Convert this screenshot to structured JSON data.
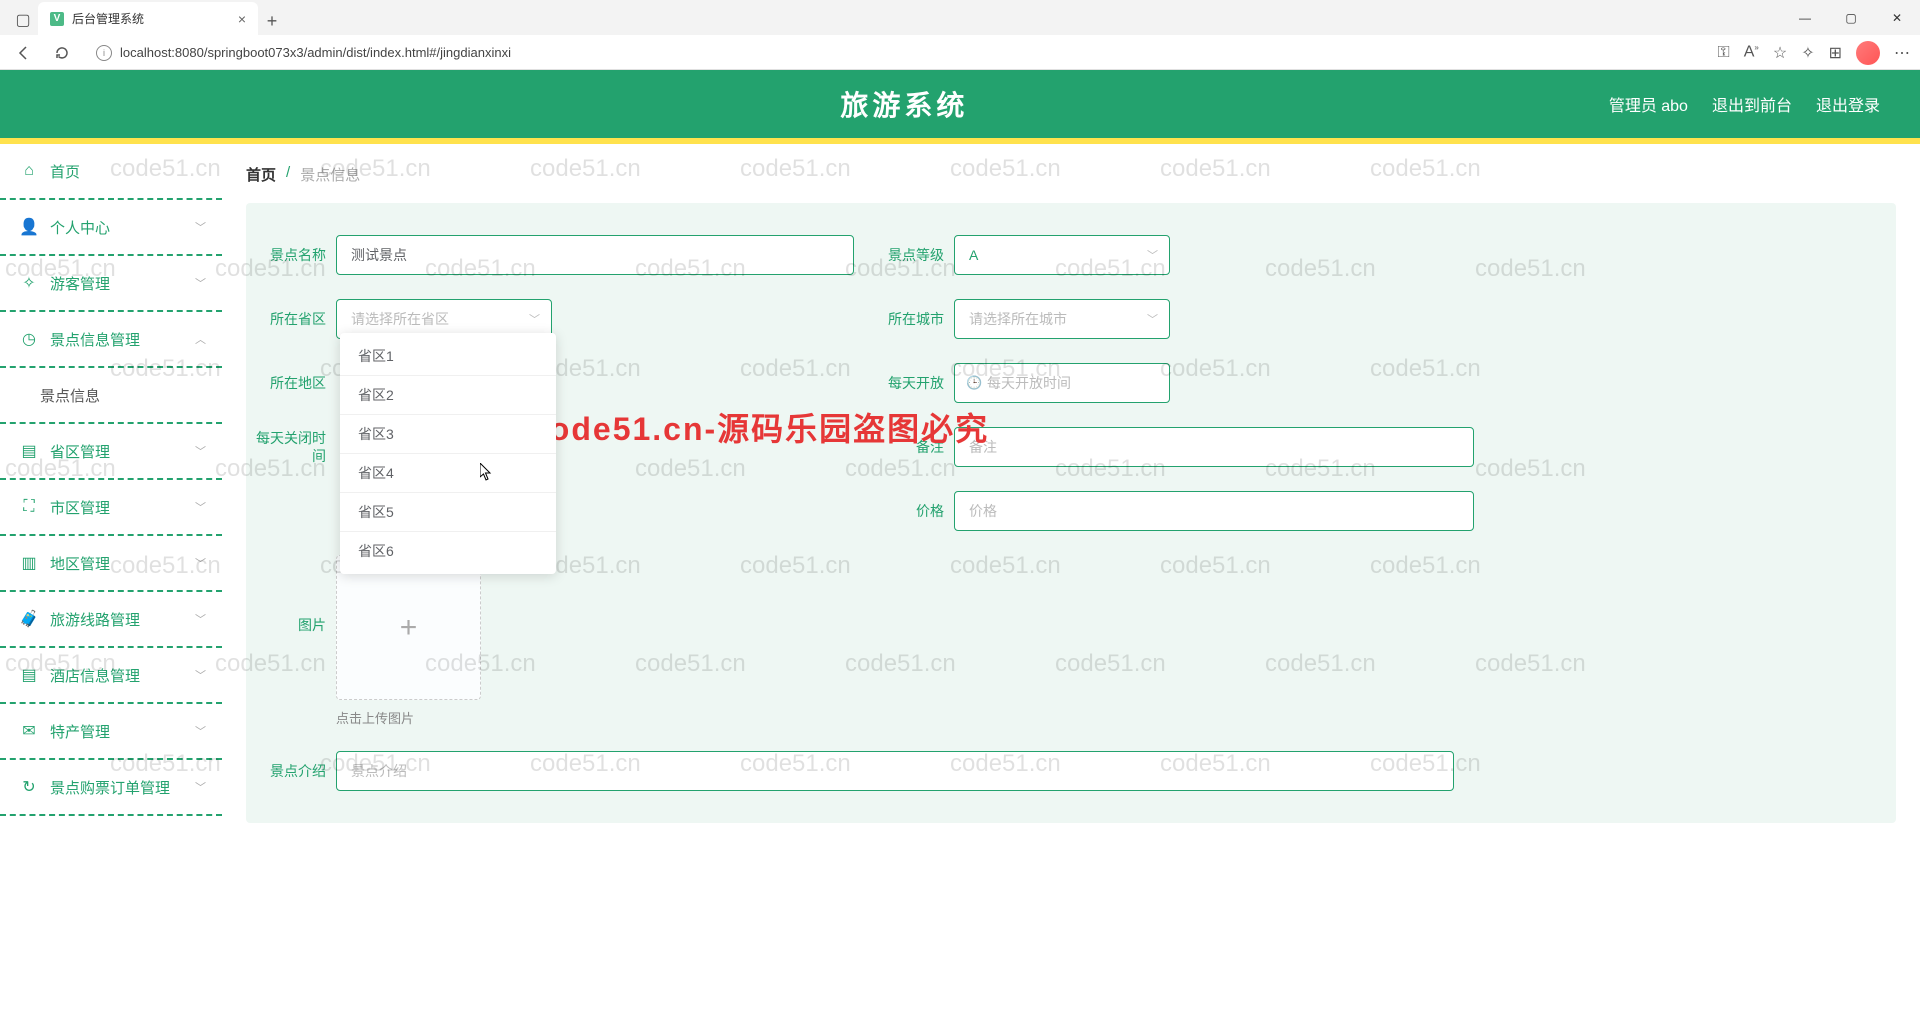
{
  "browser": {
    "tab_title": "后台管理系统",
    "url": "localhost:8080/springboot073x3/admin/dist/index.html#/jingdianxinxi"
  },
  "header": {
    "title": "旅游系统",
    "user_label": "管理员 abo",
    "front_link": "退出到前台",
    "logout": "退出登录"
  },
  "sidebar": {
    "home": "首页",
    "personal": "个人中心",
    "visitor": "游客管理",
    "scenic_mgmt": "景点信息管理",
    "scenic_info": "景点信息",
    "province": "省区管理",
    "city": "市区管理",
    "district": "地区管理",
    "route": "旅游线路管理",
    "hotel": "酒店信息管理",
    "specialty": "特产管理",
    "ticket_order": "景点购票订单管理"
  },
  "breadcrumb": {
    "home": "首页",
    "current": "景点信息"
  },
  "form": {
    "name_label": "景点名称",
    "name_value": "测试景点",
    "level_label": "景点等级",
    "level_value": "A",
    "province_label": "所在省区",
    "province_placeholder": "请选择所在省区",
    "city_label": "所在城市",
    "city_placeholder": "请选择所在城市",
    "district_label": "所在地区",
    "open_label": "每天开放",
    "open_placeholder": "每天开放时间",
    "close_time_label": "每天关闭时间",
    "remark_label": "备注",
    "remark_placeholder": "备注",
    "price_label": "价格",
    "price_placeholder": "价格",
    "image_label": "图片",
    "upload_hint": "点击上传图片",
    "intro_label": "景点介绍",
    "intro_placeholder": "景点介绍"
  },
  "dropdown": {
    "options": [
      "省区1",
      "省区2",
      "省区3",
      "省区4",
      "省区5",
      "省区6"
    ]
  },
  "watermark": {
    "text": "code51.cn",
    "red": "code51.cn-源码乐园盗图必究"
  }
}
